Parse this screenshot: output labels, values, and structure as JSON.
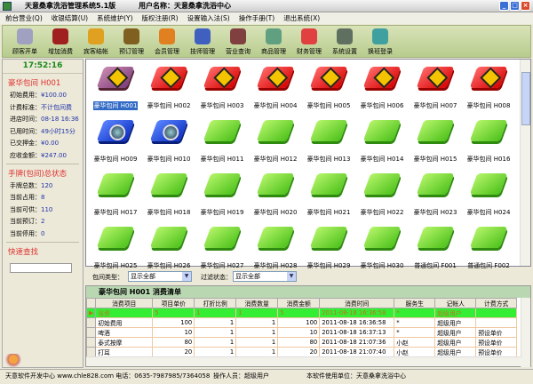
{
  "title": {
    "app": "天意桑拿洗浴管理系统5.1版",
    "user": "用户名称：天意桑拿洗浴中心"
  },
  "menu": [
    "前台营业(Q)",
    "收银结算(U)",
    "系统维护(Y)",
    "版权注册(R)",
    "设置输入法(S)",
    "操作手册(T)",
    "退出系统(X)"
  ],
  "toolbar": [
    {
      "label": "顾客开单",
      "icon": "keys-icon",
      "color": "#a0a0c0"
    },
    {
      "label": "增加消费",
      "icon": "wine-icon",
      "color": "#a02020"
    },
    {
      "label": "宾客结帐",
      "icon": "coins-icon",
      "color": "#e0a020"
    },
    {
      "label": "预订管理",
      "icon": "alarm-clock-icon",
      "color": "#806020"
    },
    {
      "label": "会员管理",
      "icon": "members-icon",
      "color": "#e08020"
    },
    {
      "label": "技师管理",
      "icon": "finder-icon",
      "color": "#4060c0"
    },
    {
      "label": "营业查询",
      "icon": "query-icon",
      "color": "#804040"
    },
    {
      "label": "商品管理",
      "icon": "goods-icon",
      "color": "#60a080"
    },
    {
      "label": "财务管理",
      "icon": "finance-icon",
      "color": "#e04040"
    },
    {
      "label": "系统设置",
      "icon": "settings-icon",
      "color": "#607060"
    },
    {
      "label": "换班登录",
      "icon": "handshake-icon",
      "color": "#40a0a0"
    }
  ],
  "left": {
    "clock": "17:52:16",
    "room_title": "豪华包间",
    "room_no": "H001",
    "info": [
      {
        "k": "初始费用：",
        "v": "¥100.00"
      },
      {
        "k": "计费标准：",
        "v": "不计包间费"
      },
      {
        "k": "进店时间：",
        "v": "08-18 16:36"
      },
      {
        "k": "已用时间：",
        "v": "49小时15分"
      },
      {
        "k": "已交押金：",
        "v": "¥0.00"
      },
      {
        "k": "应收金额：",
        "v": "¥247.00"
      }
    ],
    "status_title": "手牌(包间)总状态",
    "status": [
      {
        "k": "手牌总数：",
        "v": "120"
      },
      {
        "k": "当前占用：",
        "v": "8"
      },
      {
        "k": "当前可供：",
        "v": "110"
      },
      {
        "k": "当前预订：",
        "v": "2"
      },
      {
        "k": "当前停用：",
        "v": "0"
      }
    ],
    "search_title": "快速查找",
    "search_value": ""
  },
  "rooms": [
    {
      "label": "豪华包间 H001",
      "state": "purple"
    },
    {
      "label": "豪华包间 H002",
      "state": "red"
    },
    {
      "label": "豪华包间 H003",
      "state": "red"
    },
    {
      "label": "豪华包间 H004",
      "state": "red"
    },
    {
      "label": "豪华包间 H005",
      "state": "red"
    },
    {
      "label": "豪华包间 H006",
      "state": "red"
    },
    {
      "label": "豪华包间 H007",
      "state": "red"
    },
    {
      "label": "豪华包间 H008",
      "state": "red"
    },
    {
      "label": "豪华包间 H009",
      "state": "blue"
    },
    {
      "label": "豪华包间 H010",
      "state": "blue"
    },
    {
      "label": "豪华包间 H011",
      "state": "green"
    },
    {
      "label": "豪华包间 H012",
      "state": "green"
    },
    {
      "label": "豪华包间 H013",
      "state": "green"
    },
    {
      "label": "豪华包间 H014",
      "state": "green"
    },
    {
      "label": "豪华包间 H015",
      "state": "green"
    },
    {
      "label": "豪华包间 H016",
      "state": "green"
    },
    {
      "label": "豪华包间 H017",
      "state": "green"
    },
    {
      "label": "豪华包间 H018",
      "state": "green"
    },
    {
      "label": "豪华包间 H019",
      "state": "green"
    },
    {
      "label": "豪华包间 H020",
      "state": "green"
    },
    {
      "label": "豪华包间 H021",
      "state": "green"
    },
    {
      "label": "豪华包间 H022",
      "state": "green"
    },
    {
      "label": "豪华包间 H023",
      "state": "green"
    },
    {
      "label": "豪华包间 H024",
      "state": "green"
    },
    {
      "label": "豪华包间 H025",
      "state": "green"
    },
    {
      "label": "豪华包间 H026",
      "state": "green"
    },
    {
      "label": "豪华包间 H027",
      "state": "green"
    },
    {
      "label": "豪华包间 H028",
      "state": "green"
    },
    {
      "label": "豪华包间 H029",
      "state": "green"
    },
    {
      "label": "豪华包间 H030",
      "state": "green"
    },
    {
      "label": "普通包间 F001",
      "state": "green"
    },
    {
      "label": "普通包间 F002",
      "state": "green"
    }
  ],
  "filter": {
    "type_label": "包间类型：",
    "type_value": "显示全部",
    "status_label": "过滤状态：",
    "status_value": "显示全部"
  },
  "bill": {
    "title": "豪华包间 H001  消费清单",
    "columns": [
      "消费项目",
      "项目单价",
      "打折比例",
      "消费数量",
      "消费金额",
      "消费时间",
      "服务生",
      "记帐人",
      "计费方式"
    ],
    "rows": [
      [
        "浴资",
        "5",
        "1",
        "1",
        "5",
        "2011-08-18 16:36:58",
        "*",
        "超级用户",
        ""
      ],
      [
        "初始费用",
        "100",
        "1",
        "1",
        "100",
        "2011-08-18 16:36:58",
        "*",
        "超级用户",
        ""
      ],
      [
        "啤酒",
        "10",
        "1",
        "1",
        "10",
        "2011-08-18 16:37:13",
        "*",
        "超级用户",
        "预设单价"
      ],
      [
        "泰式按摩",
        "80",
        "1",
        "1",
        "80",
        "2011-08-18 21:07:36",
        "小赵",
        "超级用户",
        "预设单价"
      ],
      [
        "打耳",
        "20",
        "1",
        "1",
        "20",
        "2011-08-18 21:07:40",
        "小赵",
        "超级用户",
        "预设单价"
      ]
    ]
  },
  "status": {
    "company": "天意软件开发中心  www.chle828.com  电话：0635-7987985/7364058",
    "operator": "操作人员：超级用户",
    "unit": "本软件使用单位：天意桑拿洗浴中心"
  }
}
